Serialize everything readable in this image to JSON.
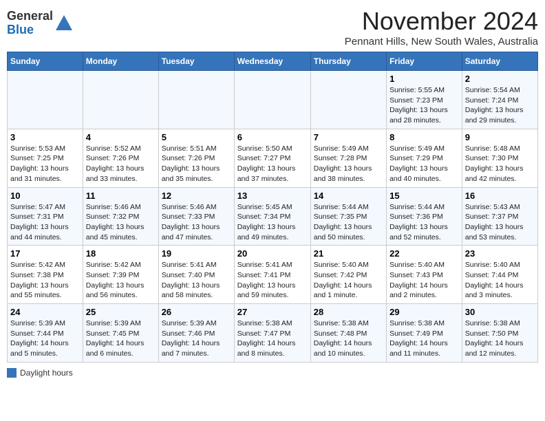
{
  "logo": {
    "general": "General",
    "blue": "Blue"
  },
  "title": "November 2024",
  "subtitle": "Pennant Hills, New South Wales, Australia",
  "days_of_week": [
    "Sunday",
    "Monday",
    "Tuesday",
    "Wednesday",
    "Thursday",
    "Friday",
    "Saturday"
  ],
  "legend_label": "Daylight hours",
  "weeks": [
    [
      {
        "day": "",
        "sunrise": "",
        "sunset": "",
        "daylight": ""
      },
      {
        "day": "",
        "sunrise": "",
        "sunset": "",
        "daylight": ""
      },
      {
        "day": "",
        "sunrise": "",
        "sunset": "",
        "daylight": ""
      },
      {
        "day": "",
        "sunrise": "",
        "sunset": "",
        "daylight": ""
      },
      {
        "day": "",
        "sunrise": "",
        "sunset": "",
        "daylight": ""
      },
      {
        "day": "1",
        "sunrise": "Sunrise: 5:55 AM",
        "sunset": "Sunset: 7:23 PM",
        "daylight": "Daylight: 13 hours and 28 minutes."
      },
      {
        "day": "2",
        "sunrise": "Sunrise: 5:54 AM",
        "sunset": "Sunset: 7:24 PM",
        "daylight": "Daylight: 13 hours and 29 minutes."
      }
    ],
    [
      {
        "day": "3",
        "sunrise": "Sunrise: 5:53 AM",
        "sunset": "Sunset: 7:25 PM",
        "daylight": "Daylight: 13 hours and 31 minutes."
      },
      {
        "day": "4",
        "sunrise": "Sunrise: 5:52 AM",
        "sunset": "Sunset: 7:26 PM",
        "daylight": "Daylight: 13 hours and 33 minutes."
      },
      {
        "day": "5",
        "sunrise": "Sunrise: 5:51 AM",
        "sunset": "Sunset: 7:26 PM",
        "daylight": "Daylight: 13 hours and 35 minutes."
      },
      {
        "day": "6",
        "sunrise": "Sunrise: 5:50 AM",
        "sunset": "Sunset: 7:27 PM",
        "daylight": "Daylight: 13 hours and 37 minutes."
      },
      {
        "day": "7",
        "sunrise": "Sunrise: 5:49 AM",
        "sunset": "Sunset: 7:28 PM",
        "daylight": "Daylight: 13 hours and 38 minutes."
      },
      {
        "day": "8",
        "sunrise": "Sunrise: 5:49 AM",
        "sunset": "Sunset: 7:29 PM",
        "daylight": "Daylight: 13 hours and 40 minutes."
      },
      {
        "day": "9",
        "sunrise": "Sunrise: 5:48 AM",
        "sunset": "Sunset: 7:30 PM",
        "daylight": "Daylight: 13 hours and 42 minutes."
      }
    ],
    [
      {
        "day": "10",
        "sunrise": "Sunrise: 5:47 AM",
        "sunset": "Sunset: 7:31 PM",
        "daylight": "Daylight: 13 hours and 44 minutes."
      },
      {
        "day": "11",
        "sunrise": "Sunrise: 5:46 AM",
        "sunset": "Sunset: 7:32 PM",
        "daylight": "Daylight: 13 hours and 45 minutes."
      },
      {
        "day": "12",
        "sunrise": "Sunrise: 5:46 AM",
        "sunset": "Sunset: 7:33 PM",
        "daylight": "Daylight: 13 hours and 47 minutes."
      },
      {
        "day": "13",
        "sunrise": "Sunrise: 5:45 AM",
        "sunset": "Sunset: 7:34 PM",
        "daylight": "Daylight: 13 hours and 49 minutes."
      },
      {
        "day": "14",
        "sunrise": "Sunrise: 5:44 AM",
        "sunset": "Sunset: 7:35 PM",
        "daylight": "Daylight: 13 hours and 50 minutes."
      },
      {
        "day": "15",
        "sunrise": "Sunrise: 5:44 AM",
        "sunset": "Sunset: 7:36 PM",
        "daylight": "Daylight: 13 hours and 52 minutes."
      },
      {
        "day": "16",
        "sunrise": "Sunrise: 5:43 AM",
        "sunset": "Sunset: 7:37 PM",
        "daylight": "Daylight: 13 hours and 53 minutes."
      }
    ],
    [
      {
        "day": "17",
        "sunrise": "Sunrise: 5:42 AM",
        "sunset": "Sunset: 7:38 PM",
        "daylight": "Daylight: 13 hours and 55 minutes."
      },
      {
        "day": "18",
        "sunrise": "Sunrise: 5:42 AM",
        "sunset": "Sunset: 7:39 PM",
        "daylight": "Daylight: 13 hours and 56 minutes."
      },
      {
        "day": "19",
        "sunrise": "Sunrise: 5:41 AM",
        "sunset": "Sunset: 7:40 PM",
        "daylight": "Daylight: 13 hours and 58 minutes."
      },
      {
        "day": "20",
        "sunrise": "Sunrise: 5:41 AM",
        "sunset": "Sunset: 7:41 PM",
        "daylight": "Daylight: 13 hours and 59 minutes."
      },
      {
        "day": "21",
        "sunrise": "Sunrise: 5:40 AM",
        "sunset": "Sunset: 7:42 PM",
        "daylight": "Daylight: 14 hours and 1 minute."
      },
      {
        "day": "22",
        "sunrise": "Sunrise: 5:40 AM",
        "sunset": "Sunset: 7:43 PM",
        "daylight": "Daylight: 14 hours and 2 minutes."
      },
      {
        "day": "23",
        "sunrise": "Sunrise: 5:40 AM",
        "sunset": "Sunset: 7:44 PM",
        "daylight": "Daylight: 14 hours and 3 minutes."
      }
    ],
    [
      {
        "day": "24",
        "sunrise": "Sunrise: 5:39 AM",
        "sunset": "Sunset: 7:44 PM",
        "daylight": "Daylight: 14 hours and 5 minutes."
      },
      {
        "day": "25",
        "sunrise": "Sunrise: 5:39 AM",
        "sunset": "Sunset: 7:45 PM",
        "daylight": "Daylight: 14 hours and 6 minutes."
      },
      {
        "day": "26",
        "sunrise": "Sunrise: 5:39 AM",
        "sunset": "Sunset: 7:46 PM",
        "daylight": "Daylight: 14 hours and 7 minutes."
      },
      {
        "day": "27",
        "sunrise": "Sunrise: 5:38 AM",
        "sunset": "Sunset: 7:47 PM",
        "daylight": "Daylight: 14 hours and 8 minutes."
      },
      {
        "day": "28",
        "sunrise": "Sunrise: 5:38 AM",
        "sunset": "Sunset: 7:48 PM",
        "daylight": "Daylight: 14 hours and 10 minutes."
      },
      {
        "day": "29",
        "sunrise": "Sunrise: 5:38 AM",
        "sunset": "Sunset: 7:49 PM",
        "daylight": "Daylight: 14 hours and 11 minutes."
      },
      {
        "day": "30",
        "sunrise": "Sunrise: 5:38 AM",
        "sunset": "Sunset: 7:50 PM",
        "daylight": "Daylight: 14 hours and 12 minutes."
      }
    ]
  ]
}
